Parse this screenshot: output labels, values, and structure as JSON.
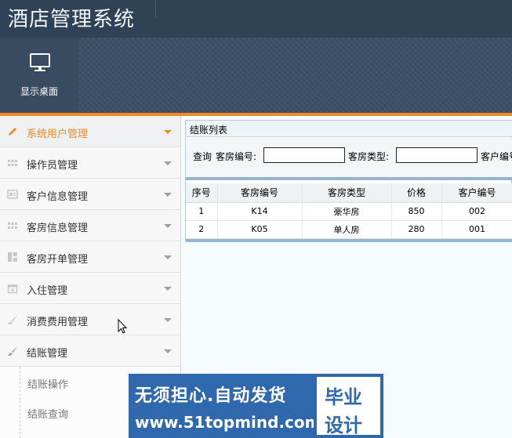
{
  "header": {
    "title": "酒店管理系统"
  },
  "toolbar": {
    "desktop_label": "显示桌面",
    "desktop_icon": "monitor-icon"
  },
  "colors": {
    "accent": "#f08a24",
    "header": "#2f4256",
    "toolbar": "#3c5068",
    "grid_border": "#95b4cf"
  },
  "sidebar": {
    "items": [
      {
        "label": "系统用户管理",
        "icon": "pencil-icon",
        "active": true
      },
      {
        "label": "操作员管理",
        "icon": "grid-icon"
      },
      {
        "label": "客户信息管理",
        "icon": "card-icon"
      },
      {
        "label": "客房信息管理",
        "icon": "grid-icon"
      },
      {
        "label": "客房开单管理",
        "icon": "layout-icon"
      },
      {
        "label": "入住管理",
        "icon": "calendar-icon"
      },
      {
        "label": "消费费用管理",
        "icon": "brush-icon"
      },
      {
        "label": "结账管理",
        "icon": "brush-icon"
      }
    ],
    "sub_items": [
      {
        "label": "结账操作"
      },
      {
        "label": "结账查询"
      }
    ]
  },
  "panel": {
    "title": "结账列表",
    "query": {
      "query_label": "查询",
      "room_no_label": "客房编号:",
      "room_type_label": "客房类型:",
      "customer_no_label": "客户编号"
    },
    "table": {
      "headers": [
        "序号",
        "客房编号",
        "客房类型",
        "价格",
        "客户编号"
      ],
      "rows": [
        [
          "1",
          "K14",
          "豪华房",
          "850",
          "002"
        ],
        [
          "2",
          "K05",
          "单人房",
          "280",
          "001"
        ]
      ]
    }
  },
  "watermark": {
    "line1": "无须担心.自动发货",
    "line2": "www.51topmind.com",
    "box_line1": "毕业",
    "box_line2": "设计"
  }
}
